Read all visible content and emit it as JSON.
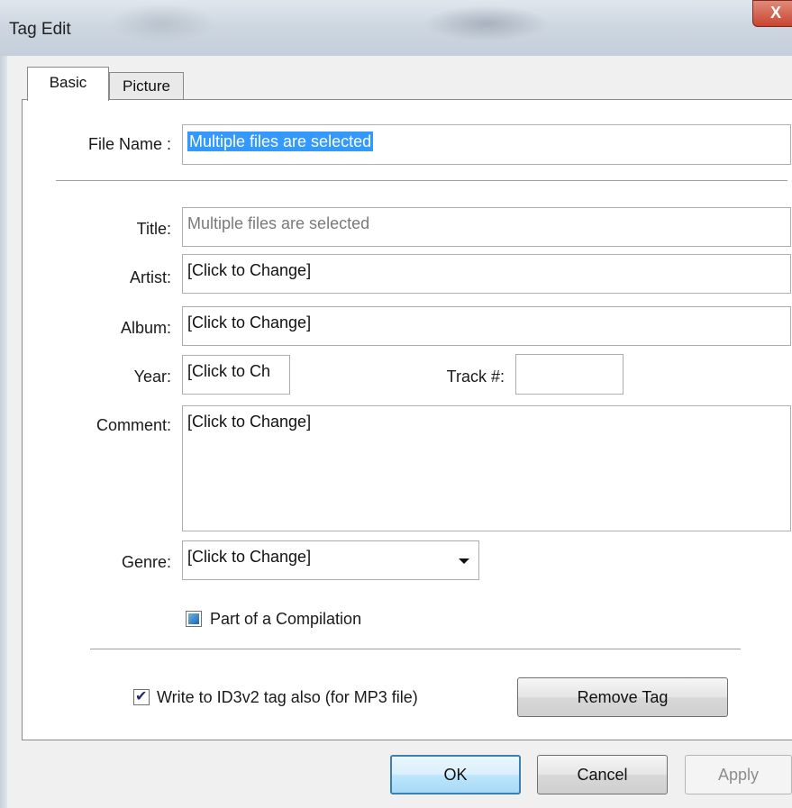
{
  "window": {
    "title": "Tag Edit",
    "close_glyph": "X"
  },
  "tabs": [
    {
      "label": "Basic",
      "active": true
    },
    {
      "label": "Picture",
      "active": false
    }
  ],
  "form": {
    "file_name": {
      "label": "File Name :",
      "value": "Multiple files are selected"
    },
    "title": {
      "label": "Title:",
      "value": "Multiple files are selected"
    },
    "artist": {
      "label": "Artist:",
      "value": "[Click to Change]"
    },
    "album": {
      "label": "Album:",
      "value": "[Click to Change]"
    },
    "year": {
      "label": "Year:",
      "value": "[Click to Ch"
    },
    "track": {
      "label": "Track #:",
      "value": ""
    },
    "comment": {
      "label": "Comment:",
      "value": "[Click to Change]"
    },
    "genre": {
      "label": "Genre:",
      "value": "[Click to Change]"
    },
    "compilation": {
      "label": "Part of a Compilation",
      "state": "indeterminate"
    },
    "write_id3v2": {
      "label": "Write to ID3v2 tag also (for MP3 file)",
      "checked": true
    }
  },
  "buttons": {
    "remove_tag": "Remove Tag",
    "ok": "OK",
    "cancel": "Cancel",
    "apply": "Apply"
  },
  "colors": {
    "selection": "#3399ff",
    "close": "#c8452f"
  }
}
